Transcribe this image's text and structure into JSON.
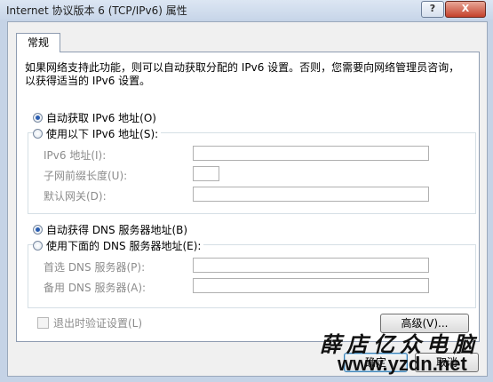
{
  "window": {
    "title": "Internet 协议版本 6 (TCP/IPv6) 属性",
    "help_glyph": "?",
    "close_glyph": "X"
  },
  "tabs": [
    {
      "label": "常规"
    }
  ],
  "description": "如果网络支持此功能，则可以自动获取分配的 IPv6 设置。否则，您需要向网络管理员咨询，以获得适当的 IPv6 设置。",
  "ip_section": {
    "auto_label": "自动获取 IPv6 地址(O)",
    "manual_label": "使用以下 IPv6 地址(S):",
    "selected": "auto",
    "fields": [
      {
        "label": "IPv6 地址(I):",
        "value": ""
      },
      {
        "label": "子网前缀长度(U):",
        "value": ""
      },
      {
        "label": "默认网关(D):",
        "value": ""
      }
    ]
  },
  "dns_section": {
    "auto_label": "自动获得 DNS 服务器地址(B)",
    "manual_label": "使用下面的 DNS 服务器地址(E):",
    "selected": "auto",
    "fields": [
      {
        "label": "首选 DNS 服务器(P):",
        "value": ""
      },
      {
        "label": "备用 DNS 服务器(A):",
        "value": ""
      }
    ]
  },
  "validate_checkbox": {
    "label": "退出时验证设置(L)",
    "checked": false,
    "enabled": false
  },
  "buttons": {
    "advanced": "高级(V)...",
    "ok": "确定",
    "cancel": "取消"
  },
  "watermark": {
    "text": "薛店亿众电脑",
    "url": "www.yzdn.net"
  }
}
